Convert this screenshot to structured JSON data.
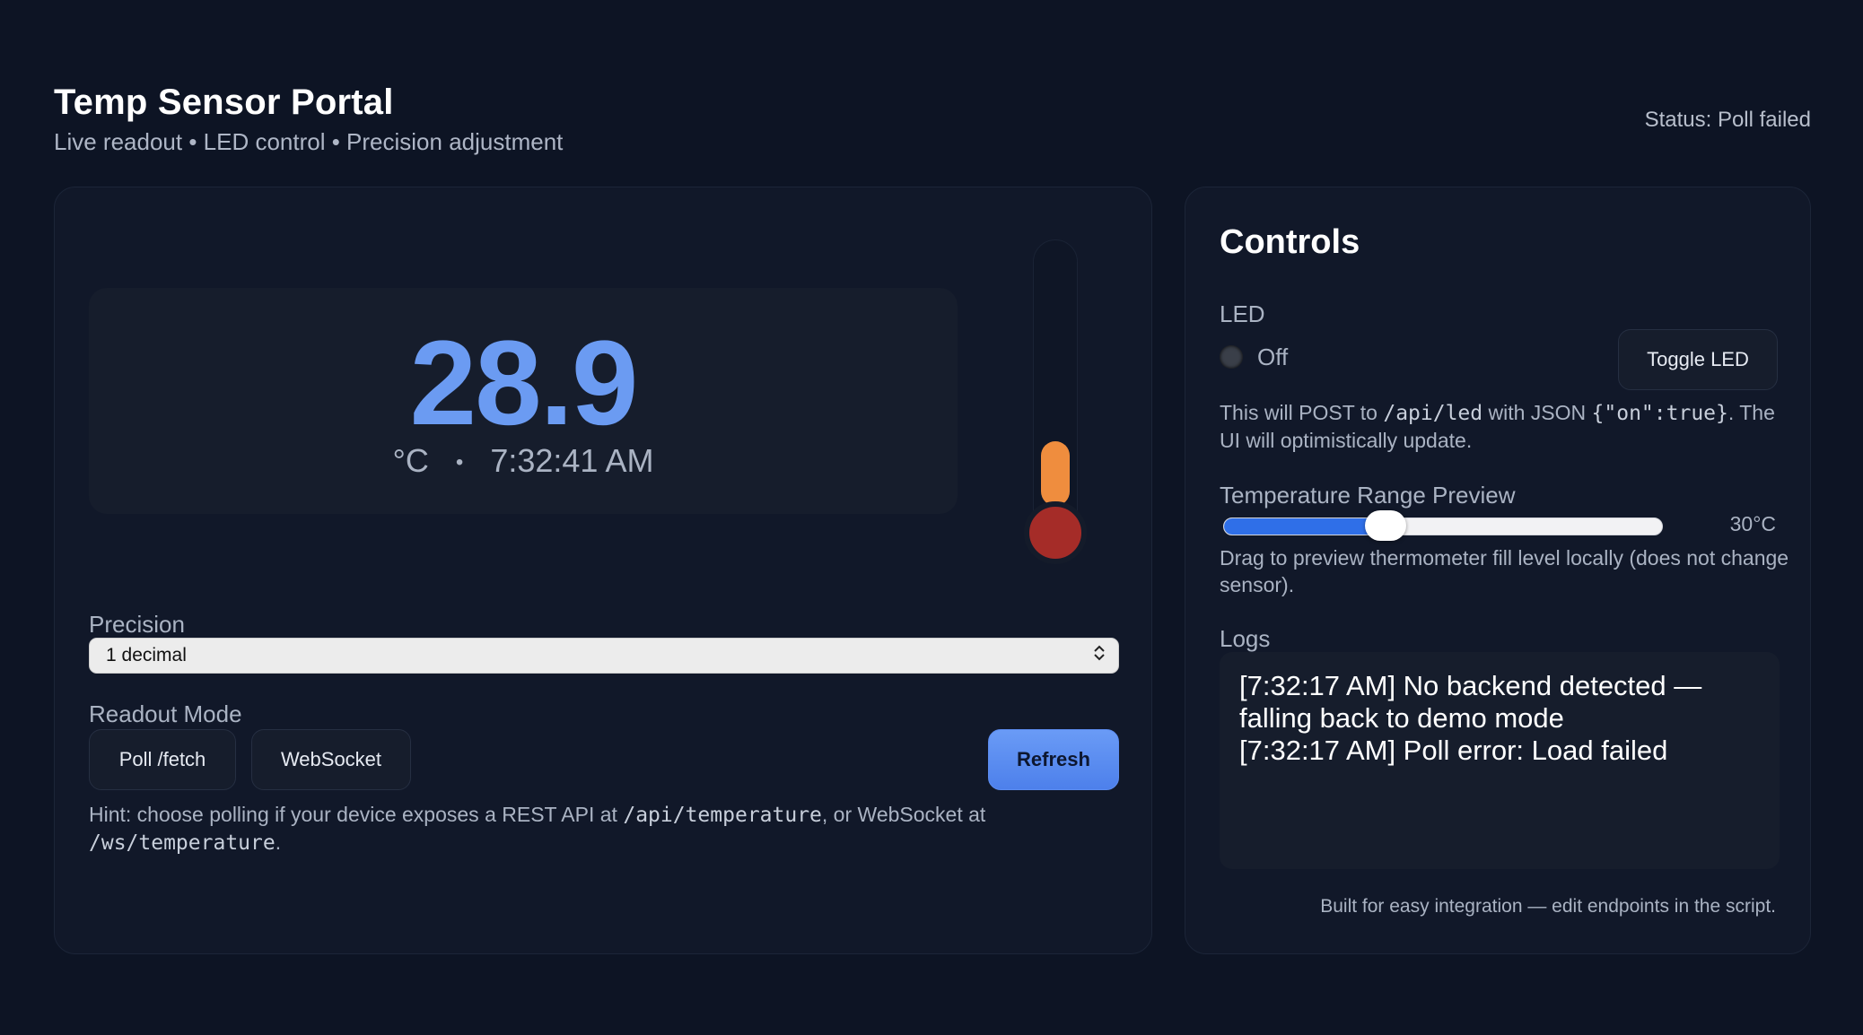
{
  "app": {
    "title": "Temp Sensor Portal",
    "subtitle": "Live readout • LED control • Precision adjustment",
    "status": "Status: Poll failed"
  },
  "readout": {
    "temperature": "28.9",
    "unit": "°C",
    "separator": "•",
    "time": "7:32:41 AM"
  },
  "thermometer": {
    "fill_level": 0.25,
    "fill_color": "#ef8d3e",
    "bulb_color": "#a52c28"
  },
  "precision": {
    "label": "Precision",
    "selected": "1 decimal",
    "chevron_icon": "updown-chevron-icon"
  },
  "mode": {
    "label": "Readout Mode",
    "poll_label": "Poll /fetch",
    "websocket_label": "WebSocket",
    "refresh_label": "Refresh",
    "hint_prefix": "Hint: choose polling if your device exposes a REST API at ",
    "hint_api": "/api/temperature",
    "hint_middle": ", or WebSocket at ",
    "hint_ws": "/ws/temperature",
    "hint_suffix": "."
  },
  "controls": {
    "title": "Controls",
    "led_label": "LED",
    "led_state": "Off",
    "led_color": "#3a3f49",
    "toggle_label": "Toggle LED",
    "led_desc_prefix": "This will POST to ",
    "led_desc_endpoint": "/api/led",
    "led_desc_middle": " with JSON ",
    "led_desc_json": "{\"on\":true}",
    "led_desc_suffix": ". The UI will optimistically update.",
    "range_label": "Temperature Range Preview",
    "range_value_text": "30°C",
    "range_level": 0.37,
    "range_desc": "Drag to preview thermometer fill level locally (does not change sensor).",
    "logs_label": "Logs",
    "logs": [
      "[7:32:17 AM] No backend detected — falling back to demo mode",
      "[7:32:17 AM] Poll error: Load failed"
    ],
    "footer": "Built for easy integration — edit endpoints in the script."
  },
  "colors": {
    "background": "#0d1424",
    "panel": "#111829",
    "accent": "#6b9bf2",
    "slider_fill": "#2f6fe8"
  }
}
